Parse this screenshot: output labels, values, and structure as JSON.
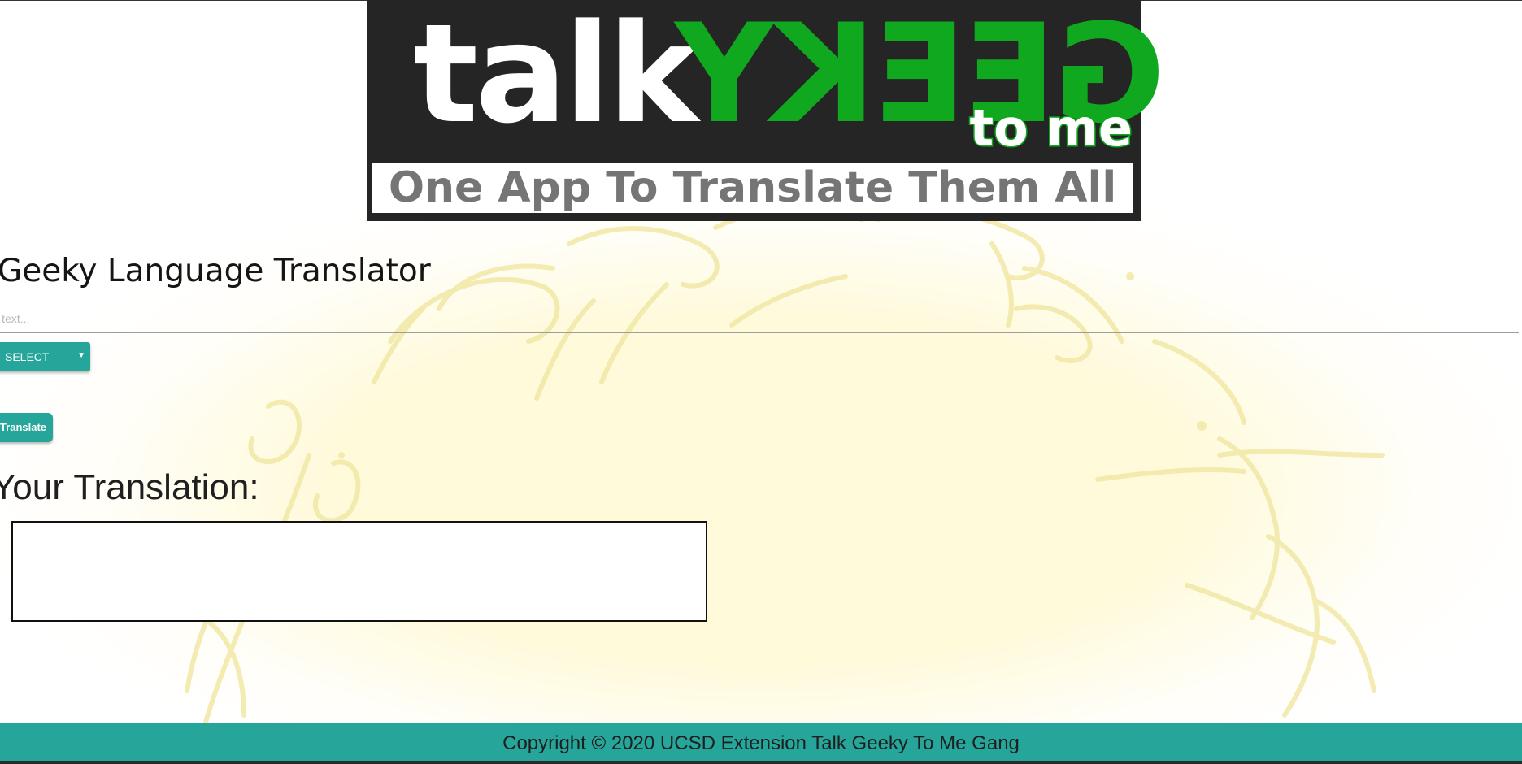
{
  "logo": {
    "word_talk": "talk",
    "word_geeky": "GEEKY",
    "word_to_me": "to me",
    "tagline": "One App To Translate Them All"
  },
  "translator": {
    "heading": "Geeky Language Translator",
    "input_placeholder": "Your text...",
    "input_value": "",
    "select_label": "SELECT",
    "translate_label": "Translate",
    "result_heading": "Your Translation:",
    "result_text": ""
  },
  "footer": {
    "copyright": "Copyright © 2020 UCSD Extension Talk Geeky To Me Gang"
  },
  "colors": {
    "accent": "#26a69a",
    "logo_background": "#252525",
    "logo_green": "#10a81f",
    "background_glow": "#fff8cd"
  },
  "icons": {
    "select_caret": "caret-down-icon"
  }
}
